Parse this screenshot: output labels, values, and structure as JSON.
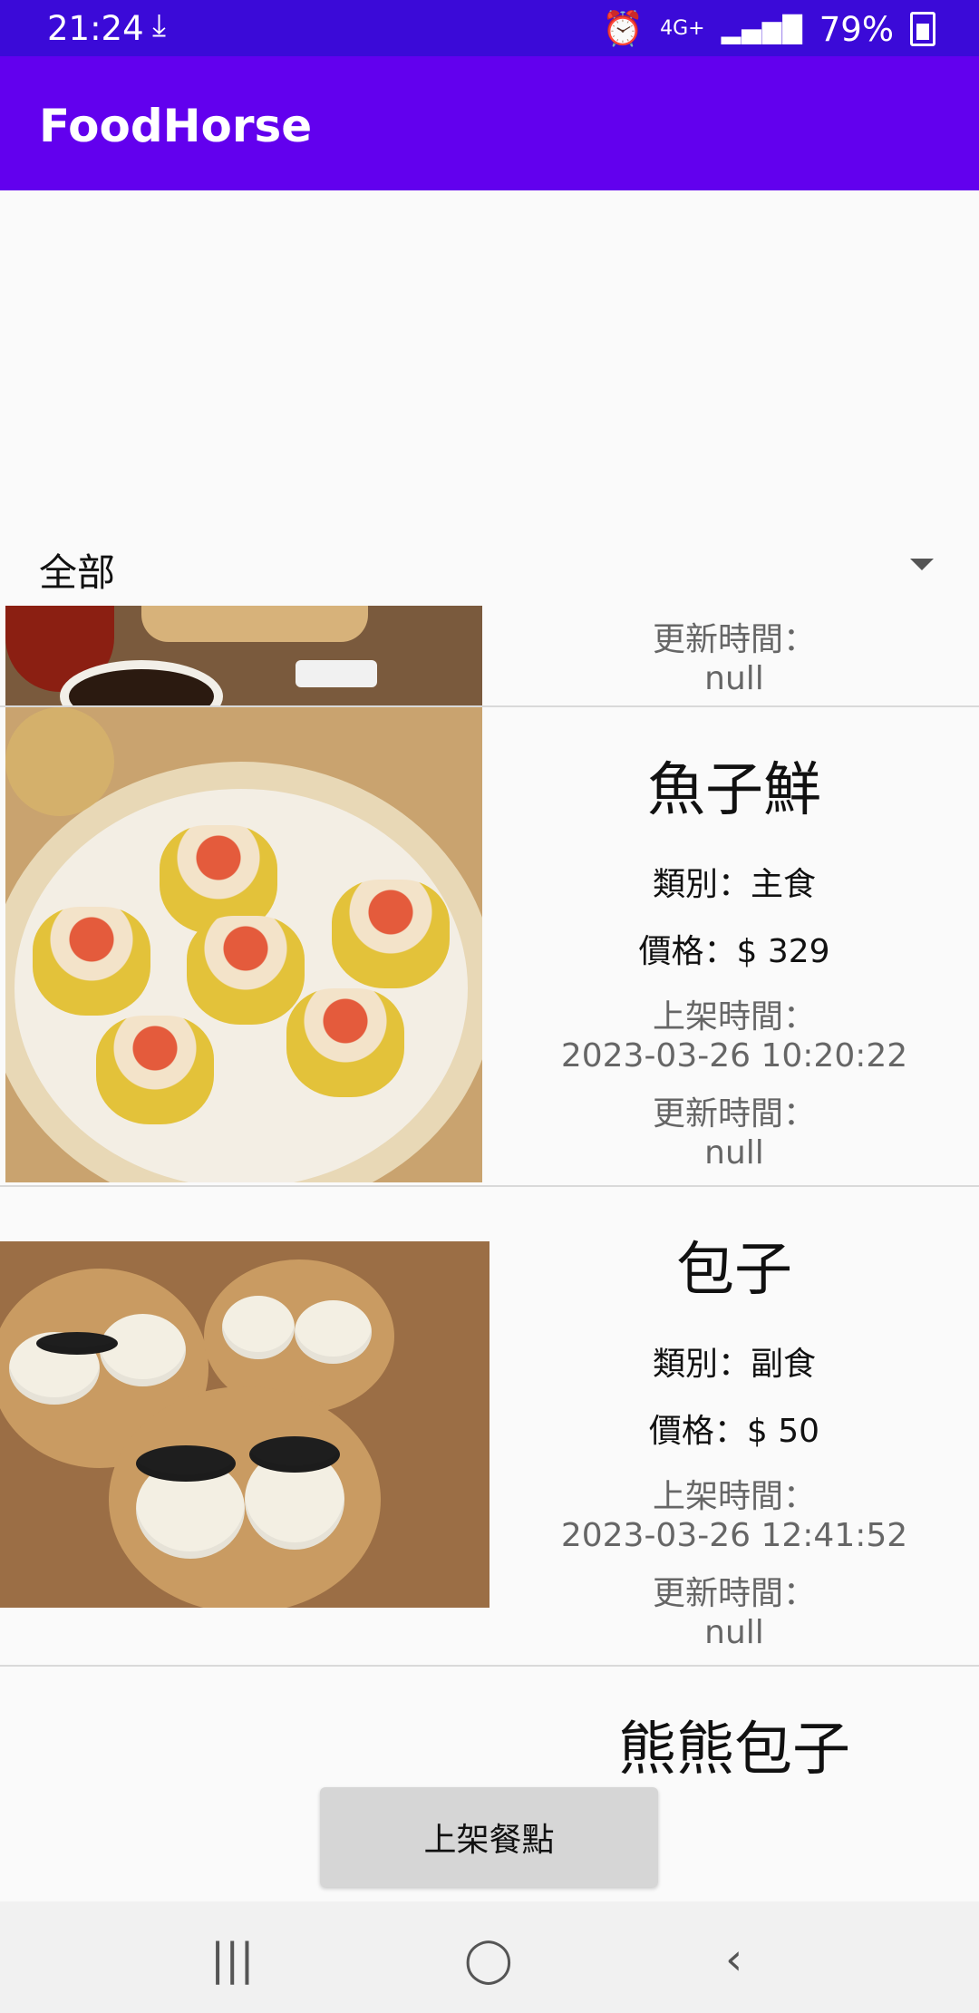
{
  "status_bar": {
    "time": "21:24",
    "net": "4G+",
    "battery": "79%"
  },
  "app_bar": {
    "title": "FoodHorse"
  },
  "filter": {
    "selected": "全部"
  },
  "items": [
    {
      "update_label": "更新時間：",
      "update_value": "null"
    },
    {
      "name": "魚子鮮",
      "category": "類別：主食",
      "price": "價格：$ 329",
      "listed_label": "上架時間：",
      "listed_value": "2023-03-26 10:20:22",
      "update_label": "更新時間：",
      "update_value": "null"
    },
    {
      "name": "包子",
      "category": "類別：副食",
      "price": "價格：$ 50",
      "listed_label": "上架時間：",
      "listed_value": "2023-03-26 12:41:52",
      "update_label": "更新時間：",
      "update_value": "null"
    },
    {
      "name": "熊熊包子"
    }
  ],
  "fab_button": {
    "label": "上架餐點"
  },
  "colors": {
    "status_bar": "#3b0ad8",
    "app_bar": "#6200ee",
    "background": "#fafafa"
  }
}
